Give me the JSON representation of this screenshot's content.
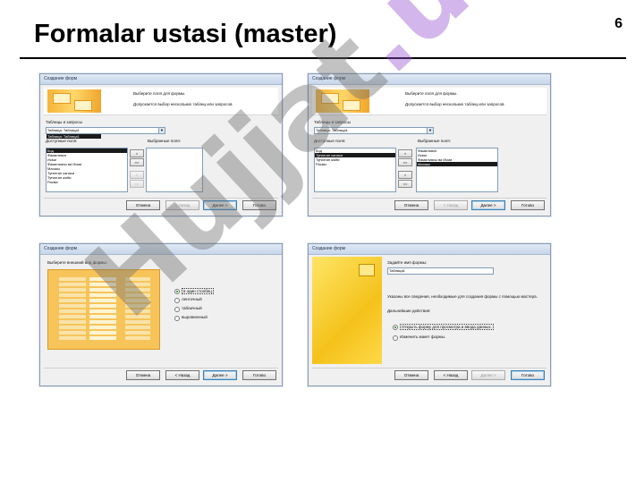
{
  "slide": {
    "title": "Formalar ustasi (master)",
    "page_number": "6"
  },
  "watermark": {
    "text_main": "Hujjat",
    "text_accent": ".uz"
  },
  "dialog_title": "Создание форм",
  "buttons": {
    "cancel": "Отмена",
    "back": "< Назад",
    "next": "Далее >",
    "finish": "Готово"
  },
  "step1": {
    "prompt": "Выберите поля для формы.",
    "hint": "Допускается выбор нескольких таблиц или запросов.",
    "tables_label": "Таблицы и запросы",
    "table_value": "Таблица: Таблица1",
    "dropdown_item": "Таблица: Таблица1",
    "available_label": "Доступные поля:",
    "selected_label": "Выбранные поля:",
    "available_fields": [
      "Код",
      "Фамилиясн",
      "Исми",
      "Фамилиясы ва Исми",
      "Маошы",
      "Туғилган санаси",
      "Туғилган жойи",
      "Расми"
    ],
    "move_buttons": [
      ">",
      ">>",
      "<",
      "<<"
    ]
  },
  "step2": {
    "prompt": "Выберите поля для формы.",
    "hint": "Допускается выбор нескольких таблиц или запросов.",
    "tables_label": "Таблицы и запросы",
    "table_value": "Таблица: Таблица1",
    "available_label": "Доступные поля:",
    "selected_label": "Выбранные поля:",
    "available_fields": [
      "Код",
      "Туғилган санаси",
      "Туғилган жойи",
      "Расми"
    ],
    "selected_fields": [
      "Фамилиясн",
      "Исми",
      "Фамилиясы ва Исми",
      "Маошы"
    ],
    "move_buttons": [
      ">",
      ">>",
      "<",
      "<<"
    ]
  },
  "step3": {
    "prompt": "Выберите внешний вид формы:",
    "layouts": [
      "в один столбец",
      "ленточный",
      "табличный",
      "выровненный"
    ]
  },
  "step4": {
    "prompt": "Задайте имя формы:",
    "form_name": "Таблица1",
    "info": "Указаны все сведения, необходимые для создания формы с помощью мастера.",
    "next_label": "Дальнейшие действия:",
    "options": [
      "Открыть форму для просмотра и ввода данных.",
      "Изменить макет формы."
    ]
  }
}
